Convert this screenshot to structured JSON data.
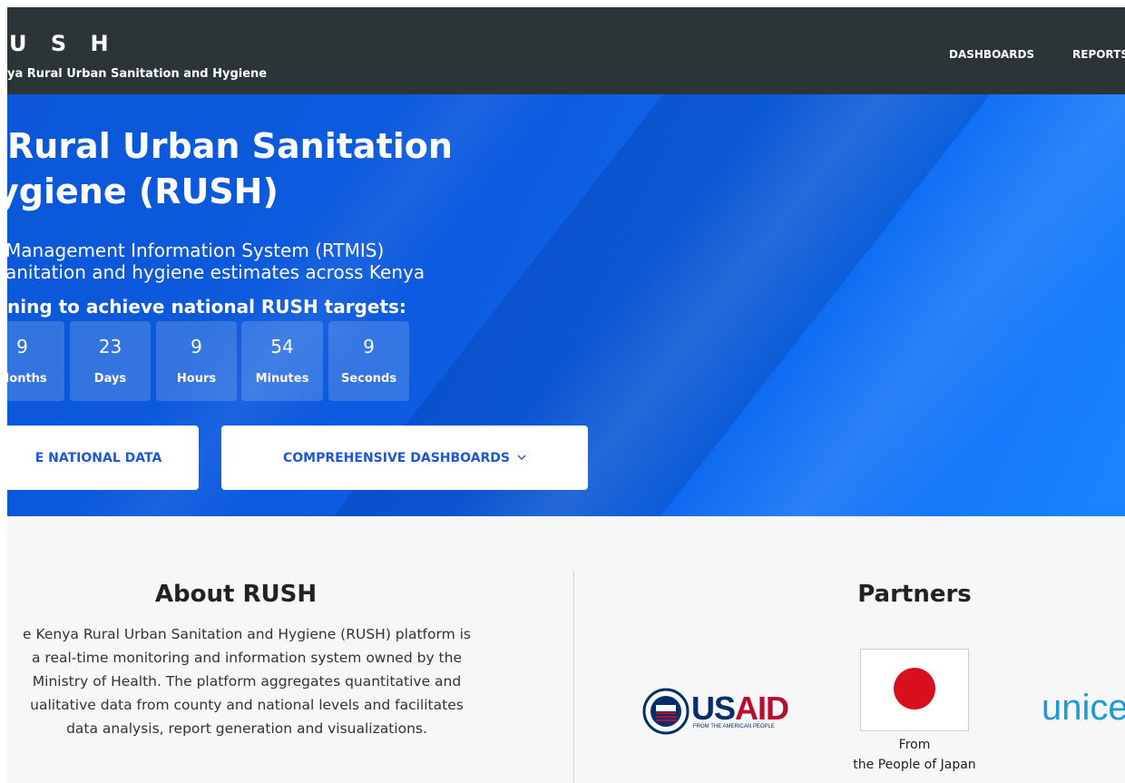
{
  "header": {
    "logo_title": "U S H",
    "logo_subtitle": "ya Rural Urban Sanitation and Hygiene",
    "nav": [
      {
        "label": "DASHBOARDS"
      },
      {
        "label": "REPORTS"
      }
    ]
  },
  "hero": {
    "title_line1": "Rural Urban Sanitation",
    "title_line2": "ygiene (RUSH)",
    "desc_line1": "Management Information System (RTMIS)",
    "desc_line2": "anitation and hygiene estimates across Kenya",
    "target_line": "ning to achieve national RUSH targets:",
    "countdown": [
      {
        "value": "9",
        "label": "Months"
      },
      {
        "value": "23",
        "label": "Days"
      },
      {
        "value": "9",
        "label": "Hours"
      },
      {
        "value": "54",
        "label": "Minutes"
      },
      {
        "value": "9",
        "label": "Seconds"
      }
    ],
    "buttons": {
      "explore": "E NATIONAL DATA",
      "dashboards": "COMPREHENSIVE DASHBOARDS"
    }
  },
  "about": {
    "title": "About RUSH",
    "lines": [
      "e Kenya Rural Urban Sanitation and Hygiene (RUSH) platform is",
      "a real-time monitoring and information system owned by the",
      "Ministry of Health. The platform aggregates quantitative and",
      "ualitative data from county and national levels and facilitates",
      "data analysis, report generation and visualizations."
    ]
  },
  "partners": {
    "title": "Partners",
    "usaid": {
      "word_blue": "US",
      "word_red": "AID",
      "tagline": "FROM THE AMERICAN PEOPLE"
    },
    "japan_caption_line1": "From",
    "japan_caption_line2": "the People of Japan",
    "unicef": "unice"
  },
  "colors": {
    "header_bg": "#2b3437",
    "hero_blue": "#0d5be0",
    "button_text": "#1c57d8",
    "usaid_blue": "#002f6c",
    "usaid_red": "#ba0c2f",
    "japan_red": "#d8101c",
    "unicef_blue": "#1c9ad6"
  }
}
